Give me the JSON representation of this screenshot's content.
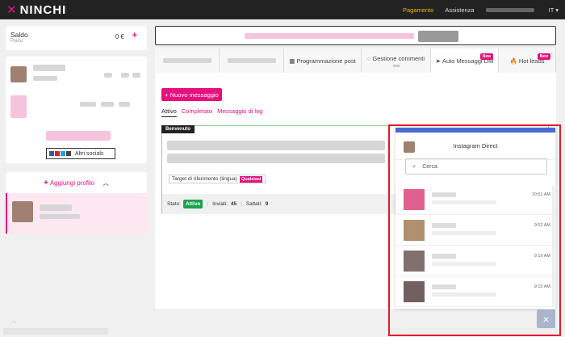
{
  "header": {
    "logo_text": "NINCHI",
    "nav": [
      {
        "label": "Pagamento"
      },
      {
        "label": "Assistenza"
      }
    ],
    "lang": "IT ▾"
  },
  "saldo": {
    "label": "Saldo",
    "sub": "Piano",
    "amount": "0 €",
    "plus": "+"
  },
  "profile": {
    "socials_label": "Altri socials"
  },
  "add_profile": {
    "label": "Aggiungi profilo",
    "plus": "+"
  },
  "tabs": [
    {
      "label": "Programmazione post"
    },
    {
      "label": "Gestione commenti"
    },
    {
      "label": "Auto Messaggi DM",
      "badge": "New"
    },
    {
      "label": "Hot leads",
      "badge": "New"
    }
  ],
  "new_message_btn": "+ Nuovo messaggio",
  "subtabs": [
    "Attivo",
    "Completato",
    "Messaggio di log"
  ],
  "message_card": {
    "label": "Benvenuto",
    "target_label": "Target di riferimento (lingua)",
    "target_value": "Qualsiasi",
    "status_label": "Stato:",
    "status_value": "Attivo",
    "sent_label": "Inviati:",
    "sent_value": "45",
    "skipped_label": "Saltati:",
    "skipped_value": "9"
  },
  "dm": {
    "title": "Instagram Direct",
    "search_placeholder": "Cerca",
    "items": [
      {
        "time": "10:51 AM",
        "color": "#e0608f"
      },
      {
        "time": "9:52 AM",
        "color": "#b09070"
      },
      {
        "time": "9:19 AM",
        "color": "#807070"
      },
      {
        "time": "9:10 AM",
        "color": "#706060"
      }
    ]
  },
  "close_label": "×",
  "colors": {
    "accent": "#e8107e",
    "dm_bar": "#4a6ad6",
    "highlight": "#e11b2a"
  }
}
